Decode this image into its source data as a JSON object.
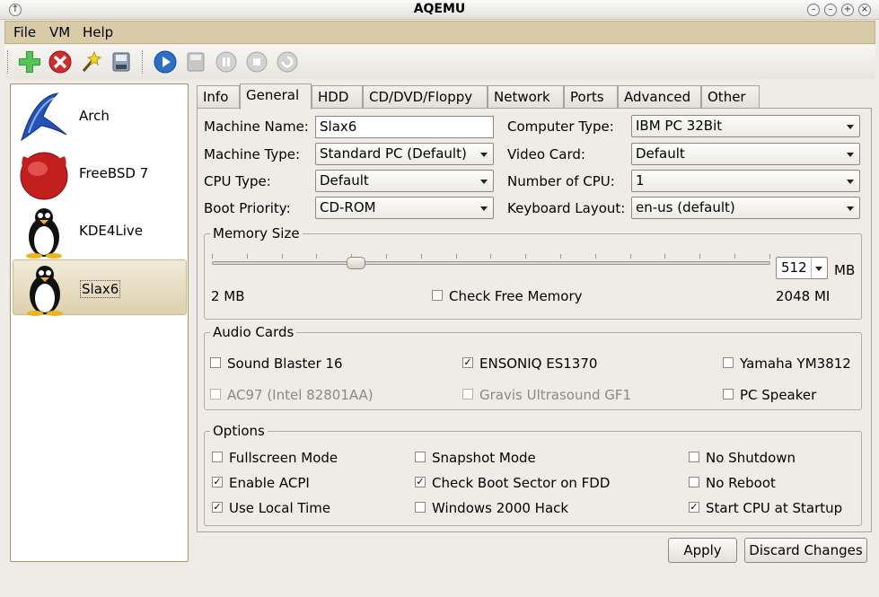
{
  "window": {
    "title": "AQEMU"
  },
  "menu": {
    "file": "File",
    "vm": "VM",
    "help": "Help"
  },
  "toolbar": {
    "icons": [
      "add-vm-icon",
      "delete-vm-icon",
      "wizard-icon",
      "save-icon",
      "start-icon",
      "save-state-icon",
      "pause-icon",
      "stop-icon",
      "reset-icon"
    ]
  },
  "vm_list": [
    {
      "name": "Arch"
    },
    {
      "name": "FreeBSD 7"
    },
    {
      "name": "KDE4Live"
    },
    {
      "name": "Slax6"
    }
  ],
  "tabs": [
    "Info",
    "General",
    "HDD",
    "CD/DVD/Floppy",
    "Network",
    "Ports",
    "Advanced",
    "Other"
  ],
  "general": {
    "machine_name_label": "Machine Name:",
    "machine_name_value": "Slax6",
    "machine_type_label": "Machine Type:",
    "machine_type_value": "Standard PC (Default)",
    "cpu_type_label": "CPU Type:",
    "cpu_type_value": "Default",
    "boot_priority_label": "Boot Priority:",
    "boot_priority_value": "CD-ROM",
    "computer_type_label": "Computer Type:",
    "computer_type_value": "IBM PC 32Bit",
    "video_card_label": "Video Card:",
    "video_card_value": "Default",
    "num_cpu_label": "Number of CPU:",
    "num_cpu_value": "1",
    "keyboard_label": "Keyboard Layout:",
    "keyboard_value": "en-us (default)"
  },
  "memory": {
    "title": "Memory Size",
    "value": "512",
    "unit": "MB",
    "min_label": "2 MB",
    "max_label": "2048 MI",
    "check_free": "Check Free Memory",
    "check_free_checked": false
  },
  "audio": {
    "title": "Audio Cards",
    "sb16": "Sound Blaster 16",
    "es1370": "ENSONIQ ES1370",
    "ym3812": "Yamaha YM3812",
    "ac97": "AC97 (Intel 82801AA)",
    "gus": "Gravis Ultrasound GF1",
    "pcspk": "PC Speaker"
  },
  "options": {
    "title": "Options",
    "fullscreen": "Fullscreen Mode",
    "snapshot": "Snapshot Mode",
    "noshutdown": "No Shutdown",
    "acpi": "Enable ACPI",
    "bootsector": "Check Boot Sector on FDD",
    "noreboot": "No Reboot",
    "localtime": "Use Local Time",
    "win2k": "Windows 2000 Hack",
    "startcpu": "Start CPU at Startup"
  },
  "buttons": {
    "apply": "Apply",
    "discard": "Discard Changes"
  },
  "colors": {
    "menubar": "#d8cba8",
    "selection": "#ddd0ae"
  }
}
